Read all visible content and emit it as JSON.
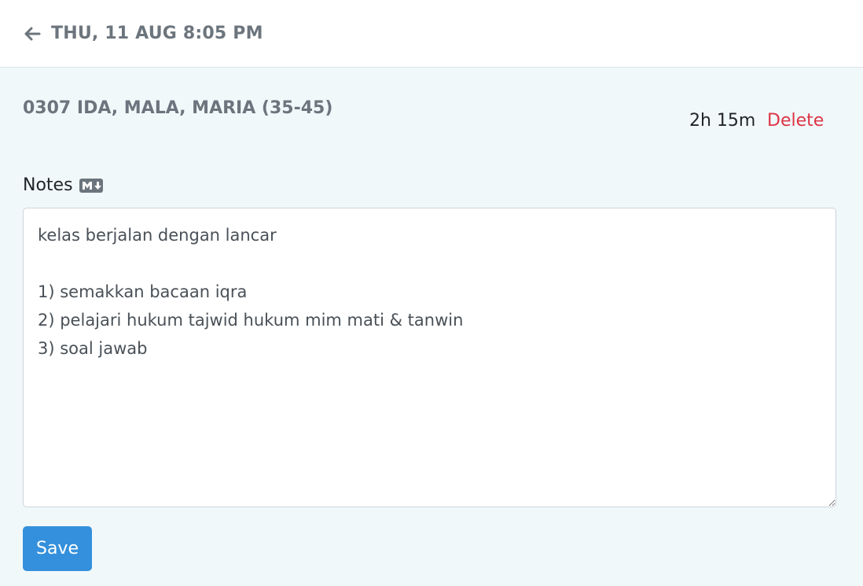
{
  "header": {
    "back_icon": "arrow-left-icon",
    "title": "THU, 11 AUG 8:05 PM"
  },
  "event": {
    "name": "0307 IDA, MALA, MARIA (35-45)",
    "duration": "2h 15m",
    "delete_label": "Delete"
  },
  "notes": {
    "label": "Notes",
    "markdown_icon": "markdown-icon",
    "value": "kelas berjalan dengan lancar\n\n1) semakkan bacaan iqra\n2) pelajari hukum tajwid hukum mim mati & tanwin\n3) soal jawab"
  },
  "actions": {
    "save_label": "Save"
  },
  "colors": {
    "background": "#f1f8fa",
    "primary": "#3490dc",
    "danger": "#dc3545",
    "muted": "#6c757d"
  }
}
